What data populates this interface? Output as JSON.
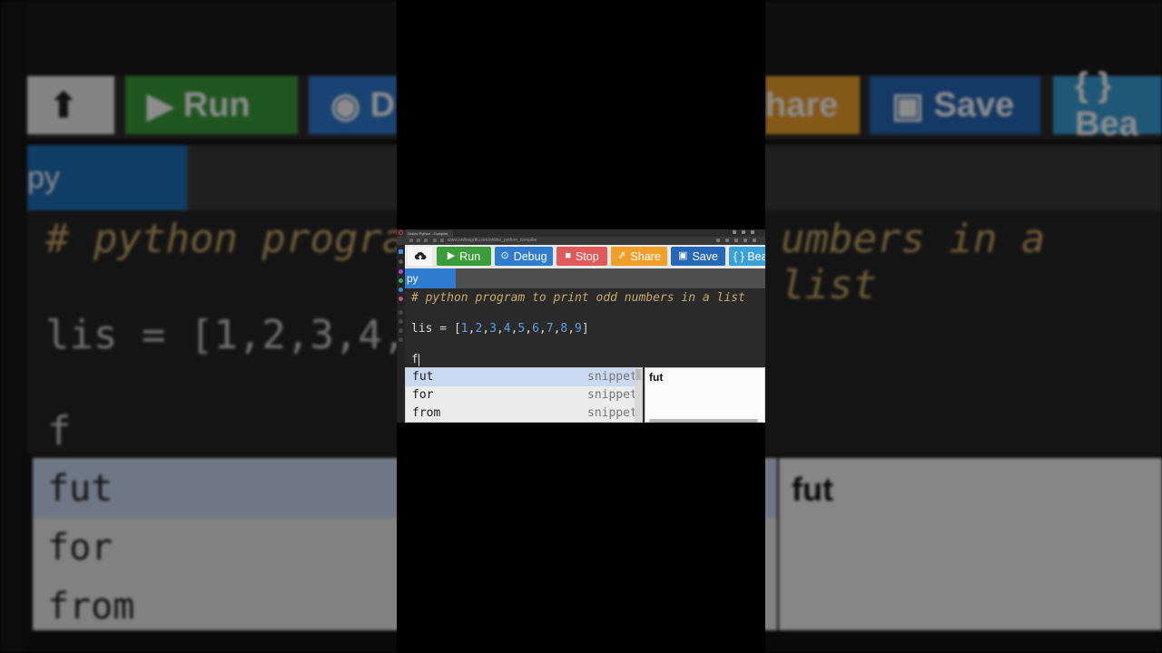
{
  "browser": {
    "tab_title": "Online Python - Compiler",
    "address": "www.onlinegdb.com/online_python_compiler"
  },
  "toolbar": {
    "upload_icon": "cloud-upload-icon",
    "buttons": [
      {
        "label": "Run",
        "icon": "play-icon",
        "color": "#3a9d3a"
      },
      {
        "label": "Debug",
        "icon": "debug-icon",
        "color": "#2f7bcf"
      },
      {
        "label": "Stop",
        "icon": "stop-icon",
        "color": "#e05a5a"
      },
      {
        "label": "Share",
        "icon": "share-icon",
        "color": "#f0a02a"
      },
      {
        "label": "Save",
        "icon": "save-icon",
        "color": "#2668b8"
      },
      {
        "label": "{ } Bea",
        "icon": "beautify-icon",
        "color": "#3aa0d8"
      }
    ]
  },
  "file_tab": {
    "label": "py"
  },
  "editor": {
    "comment_line": "# python program to print odd numbers in a list",
    "lis_ident": "lis",
    "lis_eq": " = ",
    "open_bracket": "[",
    "close_bracket": "]",
    "numbers": [
      "1",
      "2",
      "3",
      "4",
      "5",
      "6",
      "7",
      "8",
      "9"
    ],
    "typed": "f"
  },
  "autocomplete": {
    "items": [
      {
        "caption": "fut",
        "meta": "snippet",
        "selected": true
      },
      {
        "caption": "for",
        "meta": "snippet",
        "selected": false
      },
      {
        "caption": "from",
        "meta": "snippet",
        "selected": false
      }
    ],
    "doc_title": "fut"
  },
  "bg_zoom": {
    "run": "Run",
    "debug": "D",
    "share": "hare",
    "save": "Save",
    "beautify": "{ } Bea",
    "tab": "py",
    "comment_left": "# python progra",
    "comment_right": "umbers in a list",
    "lis_left": "lis = [1,2,3,4,",
    "typed": "f",
    "items": [
      "fut",
      "for",
      "from"
    ],
    "doc_title": "fut"
  }
}
